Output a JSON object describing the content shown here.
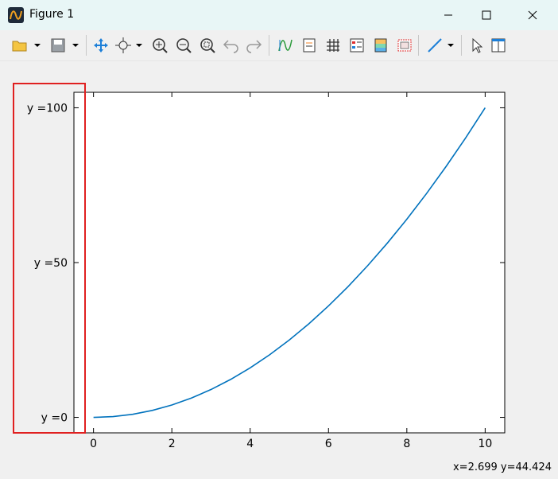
{
  "window": {
    "title": "Figure 1"
  },
  "toolbar": {
    "icons": [
      "open-file-icon",
      "save-icon",
      "pan-icon",
      "zoom-move-icon",
      "zoom-in-icon",
      "zoom-out-icon",
      "zoom-fit-icon",
      "undo-icon",
      "redo-icon",
      "curve-icon",
      "edit-axis-icon",
      "grid-icon",
      "legend-icon",
      "colormap-icon",
      "frame-icon",
      "line-style-icon",
      "pointer-icon",
      "panel-icon"
    ]
  },
  "status": {
    "coords": "x=2.699 y=44.424"
  },
  "chart_data": {
    "type": "line",
    "title": "",
    "xlabel": "",
    "ylabel": "",
    "xlim": [
      -0.5,
      10.5
    ],
    "ylim": [
      -5,
      105
    ],
    "x_ticks": [
      0,
      2,
      4,
      6,
      8,
      10
    ],
    "x_tick_labels": [
      "0",
      "2",
      "4",
      "6",
      "8",
      "10"
    ],
    "y_ticks": [
      0,
      50,
      100
    ],
    "y_tick_labels": [
      "y =0",
      "y =50",
      "y =100"
    ],
    "grid": false,
    "series": [
      {
        "color": "#0072bd",
        "x": [
          0,
          0.5,
          1,
          1.5,
          2,
          2.5,
          3,
          3.5,
          4,
          4.5,
          5,
          5.5,
          6,
          6.5,
          7,
          7.5,
          8,
          8.5,
          9,
          9.5,
          10
        ],
        "values": [
          0,
          0.25,
          1,
          2.25,
          4,
          6.25,
          9,
          12.25,
          16,
          20.25,
          25,
          30.25,
          36,
          42.25,
          49,
          56.25,
          64,
          72.25,
          81,
          90.25,
          100
        ]
      }
    ],
    "highlight_box_color": "#e02020"
  }
}
